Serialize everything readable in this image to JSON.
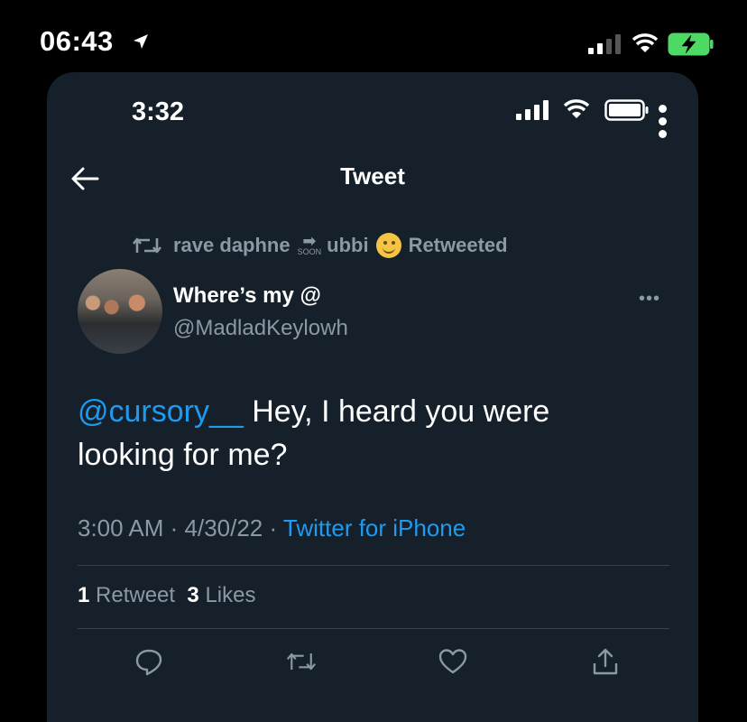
{
  "outer_status": {
    "time": "06:43"
  },
  "inner_status": {
    "time": "3:32"
  },
  "header": {
    "title": "Tweet"
  },
  "retweet_banner": {
    "user": "rave daphne",
    "soon_text": "SOON",
    "user2": "ubbi",
    "action": "Retweeted"
  },
  "author": {
    "name": "Where’s my @",
    "handle": "@MadladKeylowh"
  },
  "tweet": {
    "mention": "@cursory__",
    "text_after_mention": " Hey, I heard you were looking for me?"
  },
  "meta": {
    "time": "3:00 AM",
    "sep1": " · ",
    "date": "4/30/22",
    "sep2": " · ",
    "source": "Twitter for iPhone"
  },
  "stats": {
    "retweets_count": "1",
    "retweets_label": " Retweet",
    "likes_count": "3",
    "likes_label": " Likes"
  },
  "icons": [
    "location-arrow-icon",
    "signal-icon",
    "wifi-icon",
    "battery-charging-icon",
    "more-vertical-icon",
    "back-arrow-icon",
    "retweet-icon",
    "more-horizontal-icon",
    "reply-icon",
    "like-icon",
    "share-icon"
  ],
  "colors": {
    "background": "#16202b",
    "accent": "#1d9bf0",
    "muted": "#8b98a5"
  }
}
